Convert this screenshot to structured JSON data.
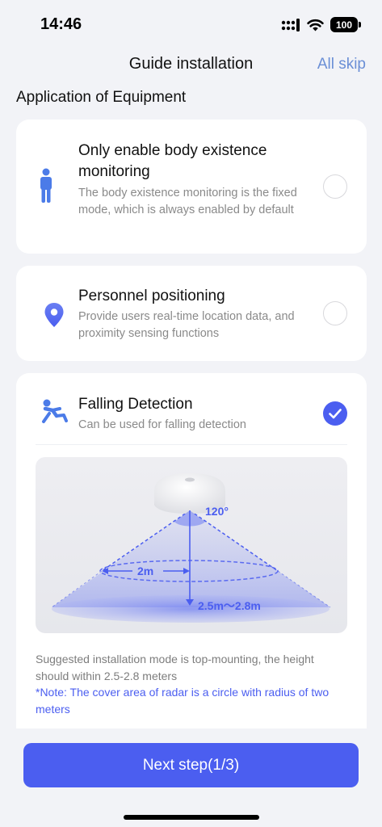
{
  "status_bar": {
    "time": "14:46",
    "battery": "100"
  },
  "nav": {
    "title": "Guide installation",
    "skip_label": "All skip"
  },
  "section": {
    "title": "Application of Equipment"
  },
  "options": [
    {
      "title": "Only enable body existence monitoring",
      "description": "The body existence monitoring is the fixed mode, which is always enabled by default",
      "icon": "person-icon",
      "checked": false
    },
    {
      "title": "Personnel positioning",
      "description": "Provide users real-time location data, and proximity sensing functions",
      "icon": "location-pin-icon",
      "checked": false
    },
    {
      "title": "Falling Detection",
      "description": "Can be used for falling detection",
      "icon": "falling-person-icon",
      "checked": true
    }
  ],
  "illustration": {
    "angle_label": "120°",
    "radius_label": "2m",
    "height_label": "2.5m～2.8m"
  },
  "notes": {
    "suggestion": "Suggested installation mode is top-mounting, the height should within 2.5-2.8 meters",
    "note": "*Note: The cover area of radar is a circle with radius of two meters"
  },
  "next_button": {
    "label": "Next step(1/3)"
  },
  "colors": {
    "accent": "#4b5ef0",
    "skip_link": "#6b8fd6",
    "background": "#f2f3f7"
  }
}
